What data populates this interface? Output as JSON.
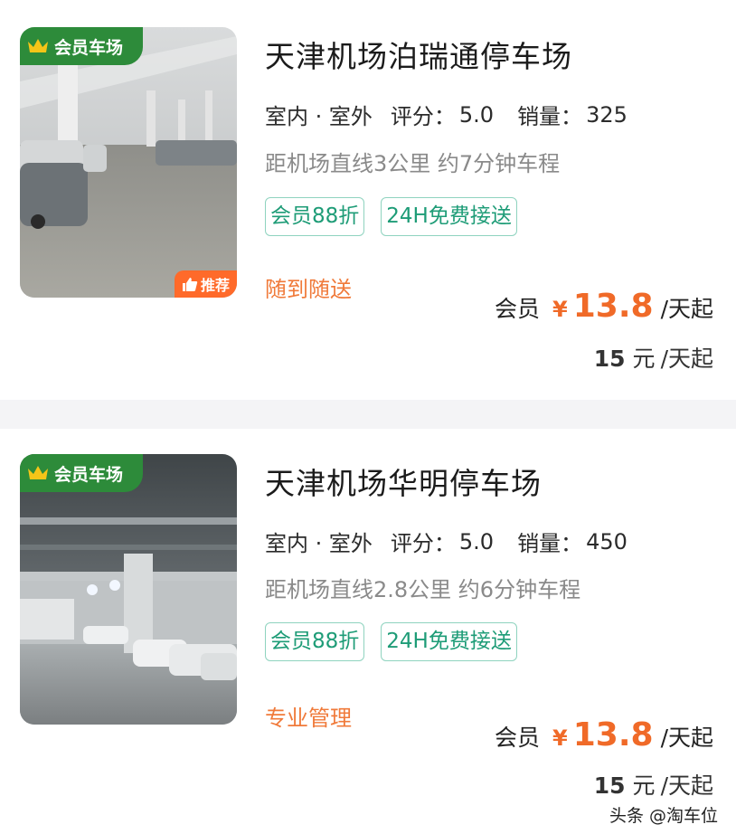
{
  "listings": [
    {
      "member_tag": "会员车场",
      "recommend_tag": "推荐",
      "title": "天津机场泊瑞通停车场",
      "type_label": "室内 · 室外",
      "rating_label": "评分：",
      "rating": "5.0",
      "sales_label": "销量：",
      "sales": "325",
      "distance": "距机场直线3公里 约7分钟车程",
      "tags": [
        "会员88折",
        "24H免费接送"
      ],
      "feature": "随到随送",
      "member_price_label": "会员",
      "currency": "¥",
      "member_price": "13.8",
      "price_unit": "/天起",
      "original_price": "15",
      "original_unit": "元",
      "original_suffix": "/天起"
    },
    {
      "member_tag": "会员车场",
      "title": "天津机场华明停车场",
      "type_label": "室内 · 室外",
      "rating_label": "评分：",
      "rating": "5.0",
      "sales_label": "销量：",
      "sales": "450",
      "distance": "距机场直线2.8公里 约6分钟车程",
      "tags": [
        "会员88折",
        "24H免费接送"
      ],
      "feature": "专业管理",
      "member_price_label": "会员",
      "currency": "¥",
      "member_price": "13.8",
      "price_unit": "/天起",
      "original_price": "15",
      "original_unit": "元",
      "original_suffix": "/天起"
    }
  ],
  "watermark": "头条 @淘车位",
  "colors": {
    "member_green": "#2d8b3a",
    "tag_teal": "#1e9c77",
    "price_orange": "#f06a28",
    "feature_orange": "#f07a3a"
  }
}
